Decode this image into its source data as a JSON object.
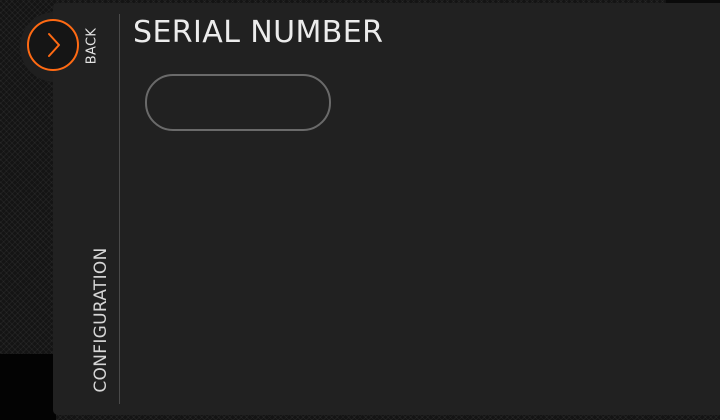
{
  "nav": {
    "back_label": "BACK",
    "section_label": "CONFIGURATION"
  },
  "page": {
    "title": "SERIAL NUMBER"
  },
  "serial_field": {
    "value": "",
    "placeholder": ""
  },
  "icons": {
    "back": "chevron-right-icon"
  },
  "colors": {
    "accent": "#ff6a13",
    "panel": "#212121",
    "text": "#ececec",
    "field_border": "#6a6a6a"
  }
}
